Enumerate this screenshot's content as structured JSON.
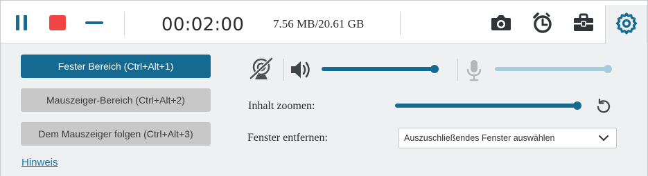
{
  "toolbar": {
    "timer": "00:02:00",
    "file_size": "7.56 MB/20.61 GB",
    "icons": [
      "pause-icon",
      "stop-icon",
      "minimize-icon",
      "camera-icon",
      "schedule-clock-icon",
      "toolbox-icon",
      "settings-gear-icon"
    ]
  },
  "modes": {
    "fixed_area": "Fester Bereich (Ctrl+Alt+1)",
    "mouse_area": "Mauszeiger-Bereich (Ctrl+Alt+2)",
    "follow_mouse": "Dem Mauszeiger folgen (Ctrl+Alt+3)",
    "active_mode": "fixed_area"
  },
  "hint_link": "Hinweis",
  "audio": {
    "webcam_state": "off",
    "system_volume": 1.0,
    "microphone_state": "off",
    "microphone_volume": 1.0
  },
  "zoom": {
    "label": "Inhalt zoomen:",
    "value": 1.0
  },
  "exclude_window": {
    "label": "Fenster entfernen:",
    "selected": "Auszuschließendes Fenster auswählen"
  },
  "colors": {
    "accent": "#156a91",
    "stop_red": "#ef4545",
    "disabled_track": "#a9ccdd",
    "panel_bg": "#eef0f2"
  }
}
